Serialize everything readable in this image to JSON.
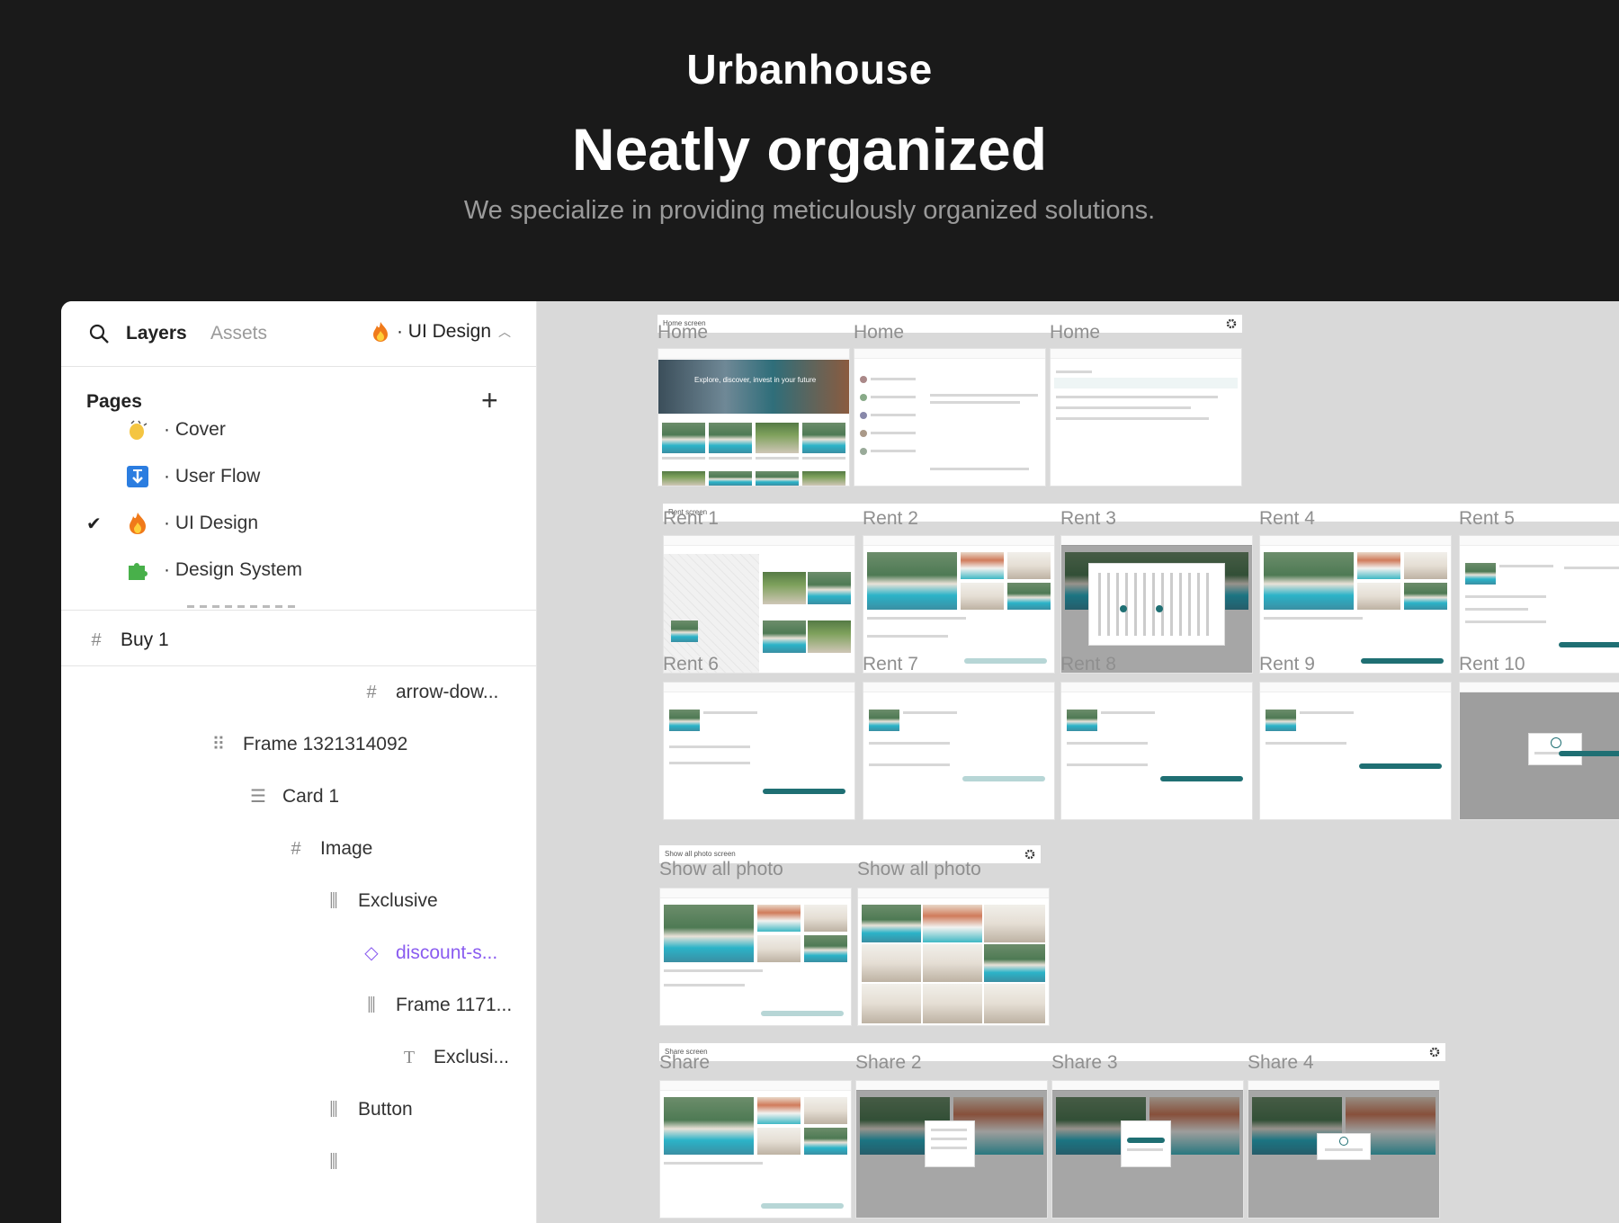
{
  "hero": {
    "brand": "Urbanhouse",
    "headline": "Neatly organized",
    "subline": "We specialize in providing meticulously organized solutions."
  },
  "panel": {
    "tabs": {
      "layers": "Layers",
      "assets": "Assets"
    },
    "current_page": "· UI Design",
    "pages_title": "Pages",
    "pages": [
      {
        "label": "· Cover",
        "icon": "clapping-hands-icon"
      },
      {
        "label": "· User Flow",
        "icon": "arrow-down-box-icon"
      },
      {
        "label": "· UI Design",
        "icon": "fire-icon",
        "selected": true
      },
      {
        "label": "· Design System",
        "icon": "puzzle-icon"
      }
    ],
    "layers": [
      {
        "label": "Buy 1",
        "icon": "frame-icon"
      },
      {
        "label": "arrow-dow...",
        "icon": "frame-icon"
      },
      {
        "label": "Frame 1321314092",
        "icon": "grid-layout-icon"
      },
      {
        "label": "Card 1",
        "icon": "vertical-stack-icon"
      },
      {
        "label": "Image",
        "icon": "frame-icon"
      },
      {
        "label": "Exclusive",
        "icon": "horizontal-stack-icon"
      },
      {
        "label": "discount-s...",
        "icon": "component-instance-icon"
      },
      {
        "label": "Frame 1171...",
        "icon": "horizontal-stack-icon"
      },
      {
        "label": "Exclusi...",
        "icon": "text-icon"
      },
      {
        "label": "Button",
        "icon": "horizontal-stack-icon"
      }
    ]
  },
  "canvas": {
    "groups": [
      {
        "header": "Home screen",
        "frames": [
          "Home",
          "Home",
          "Home"
        ]
      },
      {
        "header": "Rent screen",
        "frames": [
          "Rent 1",
          "Rent 2",
          "Rent 3",
          "Rent 4",
          "Rent 5",
          "Rent 6",
          "Rent 7",
          "Rent 8",
          "Rent 9",
          "Rent 10"
        ]
      },
      {
        "header": "Show all photo screen",
        "frames": [
          "Show all photo",
          "Show all photo"
        ]
      },
      {
        "header": "Share screen",
        "frames": [
          "Share",
          "Share 2",
          "Share 3",
          "Share 4"
        ]
      }
    ],
    "hero_caption": "Explore, discover, invest in your future"
  },
  "colors": {
    "background": "#1a1a1a",
    "accent_teal": "#1f6f73",
    "canvas": "#d9d9d9",
    "component_purple": "#8a5cf0"
  }
}
